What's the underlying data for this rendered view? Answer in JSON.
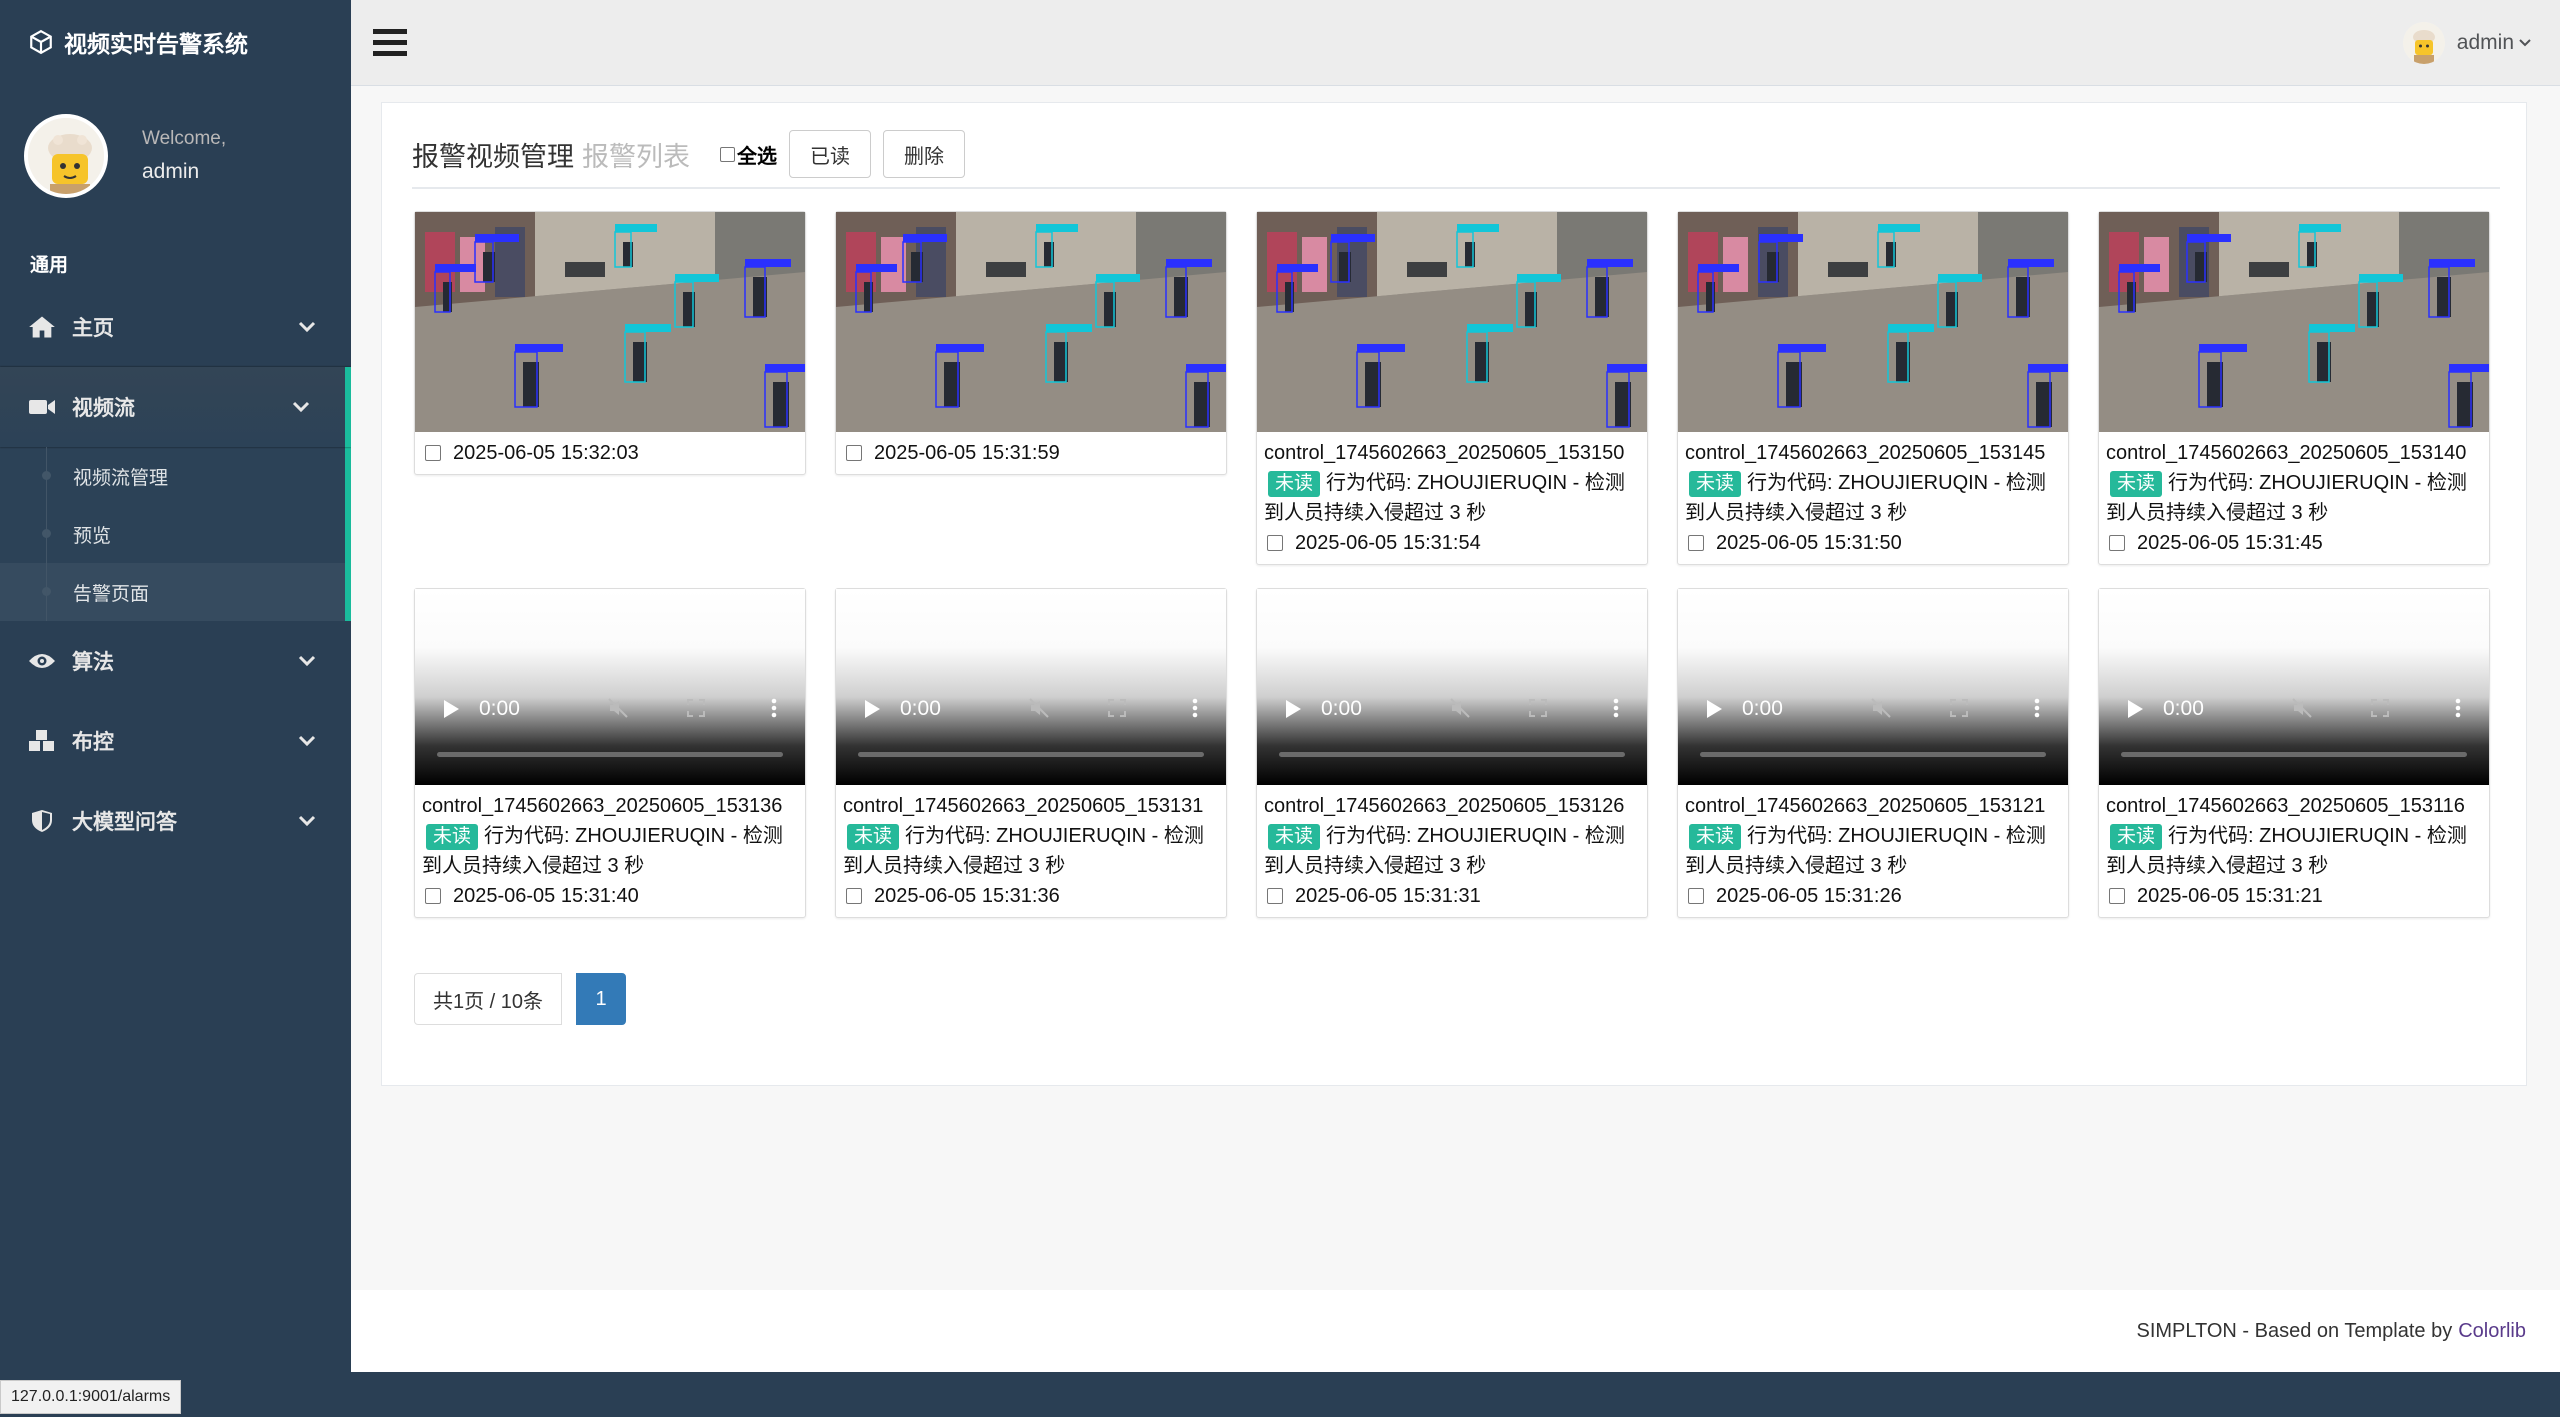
{
  "app": {
    "title": "视频实时告警系统",
    "welcome": "Welcome,",
    "username": "admin"
  },
  "sidebar": {
    "section": "通用",
    "items": [
      {
        "label": "主页",
        "icon": "home-icon"
      },
      {
        "label": "视频流",
        "icon": "video-camera-icon",
        "active": true,
        "children": [
          {
            "label": "视频流管理"
          },
          {
            "label": "预览"
          },
          {
            "label": "告警页面",
            "current": true
          }
        ]
      },
      {
        "label": "算法",
        "icon": "eye-icon"
      },
      {
        "label": "布控",
        "icon": "cubes-icon"
      },
      {
        "label": "大模型问答",
        "icon": "shield-icon"
      }
    ]
  },
  "topnav": {
    "user": "admin"
  },
  "panel": {
    "title": "报警视频管理",
    "subtitle": "报警列表",
    "select_all": "全选",
    "btn_read": "已读",
    "btn_delete": "删除"
  },
  "cards": [
    {
      "type": "image",
      "datetime": "2025-06-05 15:32:03"
    },
    {
      "type": "image",
      "datetime": "2025-06-05 15:31:59"
    },
    {
      "type": "image",
      "name": "control_1745602663_20250605_153150",
      "badge": "未读",
      "desc": "行为代码: ZHOUJIERUQIN - 检测到人员持续入侵超过 3 秒",
      "datetime": "2025-06-05 15:31:54"
    },
    {
      "type": "image",
      "name": "control_1745602663_20250605_153145",
      "badge": "未读",
      "desc": "行为代码: ZHOUJIERUQIN - 检测到人员持续入侵超过 3 秒",
      "datetime": "2025-06-05 15:31:50"
    },
    {
      "type": "image",
      "name": "control_1745602663_20250605_153140",
      "badge": "未读",
      "desc": "行为代码: ZHOUJIERUQIN - 检测到人员持续入侵超过 3 秒",
      "datetime": "2025-06-05 15:31:45"
    },
    {
      "type": "video",
      "time": "0:00",
      "name": "control_1745602663_20250605_153136",
      "badge": "未读",
      "desc": "行为代码: ZHOUJIERUQIN - 检测到人员持续入侵超过 3 秒",
      "datetime": "2025-06-05 15:31:40"
    },
    {
      "type": "video",
      "time": "0:00",
      "name": "control_1745602663_20250605_153131",
      "badge": "未读",
      "desc": "行为代码: ZHOUJIERUQIN - 检测到人员持续入侵超过 3 秒",
      "datetime": "2025-06-05 15:31:36"
    },
    {
      "type": "video",
      "time": "0:00",
      "name": "control_1745602663_20250605_153126",
      "badge": "未读",
      "desc": "行为代码: ZHOUJIERUQIN - 检测到人员持续入侵超过 3 秒",
      "datetime": "2025-06-05 15:31:31"
    },
    {
      "type": "video",
      "time": "0:00",
      "name": "control_1745602663_20250605_153121",
      "badge": "未读",
      "desc": "行为代码: ZHOUJIERUQIN - 检测到人员持续入侵超过 3 秒",
      "datetime": "2025-06-05 15:31:26"
    },
    {
      "type": "video",
      "time": "0:00",
      "name": "control_1745602663_20250605_153116",
      "badge": "未读",
      "desc": "行为代码: ZHOUJIERUQIN - 检测到人员持续入侵超过 3 秒",
      "datetime": "2025-06-05 15:31:21"
    }
  ],
  "pagination": {
    "info": "共1页 / 10条",
    "current": "1"
  },
  "footer": {
    "text": "SIMPLTON - Based on Template by",
    "link": "Colorlib"
  },
  "statusbar": {
    "url": "127.0.0.1:9001/alarms"
  },
  "colors": {
    "sidebar": "#2a3f54",
    "accent": "#1abb9c",
    "badge": "#26b99a",
    "page_active": "#337ab7"
  }
}
